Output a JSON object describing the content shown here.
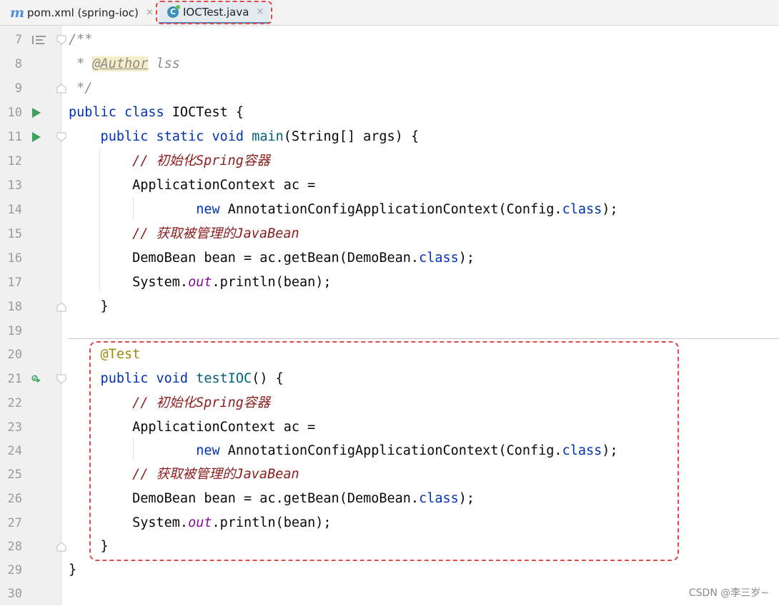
{
  "tabs": [
    {
      "label": "pom.xml (spring-ioc)",
      "icon": "maven-icon",
      "icon_glyph": "m",
      "close": "×",
      "active": false
    },
    {
      "label": "IOCTest.java",
      "icon": "java-class-icon",
      "icon_glyph": "C",
      "close": "×",
      "active": true
    }
  ],
  "editor": {
    "lines": [
      {
        "num": "7"
      },
      {
        "num": "8"
      },
      {
        "num": "9"
      },
      {
        "num": "10"
      },
      {
        "num": "11"
      },
      {
        "num": "12"
      },
      {
        "num": "13"
      },
      {
        "num": "14"
      },
      {
        "num": "15"
      },
      {
        "num": "16"
      },
      {
        "num": "17"
      },
      {
        "num": "18"
      },
      {
        "num": "19"
      },
      {
        "num": "20"
      },
      {
        "num": "21"
      },
      {
        "num": "22"
      },
      {
        "num": "23"
      },
      {
        "num": "24"
      },
      {
        "num": "25"
      },
      {
        "num": "26"
      },
      {
        "num": "27"
      },
      {
        "num": "28"
      },
      {
        "num": "29"
      },
      {
        "num": "30"
      }
    ],
    "code": {
      "l7": "/**",
      "l8_star": " * ",
      "l8_tag": "@Author",
      "l8_rest": " lss",
      "l9": " */",
      "l10_kw": "public class ",
      "l10_rest": "IOCTest {",
      "l11_kw": "    public static void ",
      "l11_fn": "main",
      "l11_rest": "(String[] args) {",
      "l12": "        // 初始化Spring容器",
      "l13": "        ApplicationContext ac =",
      "l14_kw": "                new ",
      "l14_mid": "AnnotationConfigApplicationContext(Config.",
      "l14_cls": "class",
      "l14_end": ");",
      "l15": "        // 获取被管理的JavaBean",
      "l16_a": "        DemoBean bean = ac.getBean(DemoBean.",
      "l16_cls": "class",
      "l16_end": ");",
      "l17_a": "        System.",
      "l17_out": "out",
      "l17_end": ".println(bean);",
      "l18": "    }",
      "l20": "    @Test",
      "l21_kw": "    public void ",
      "l21_fn": "testIOC",
      "l21_rest": "() {",
      "l22": "        // 初始化Spring容器",
      "l23": "        ApplicationContext ac =",
      "l24_kw": "                new ",
      "l24_mid": "AnnotationConfigApplicationContext(Config.",
      "l24_cls": "class",
      "l24_end": ");",
      "l25": "        // 获取被管理的JavaBean",
      "l26_a": "        DemoBean bean = ac.getBean(DemoBean.",
      "l26_cls": "class",
      "l26_end": ");",
      "l27_a": "        System.",
      "l27_out": "out",
      "l27_end": ".println(bean);",
      "l28": "    }",
      "l29": "}"
    }
  },
  "watermark": "CSDN @李三岁~",
  "colors": {
    "keyword": "#0033b3",
    "comment": "#8c8c8c",
    "comment_text": "#8c1b1b",
    "method": "#00627a",
    "static_field": "#871094",
    "annotation": "#9e880d",
    "highlight_border": "#e24a4a",
    "run_icon": "#3aa35a"
  }
}
